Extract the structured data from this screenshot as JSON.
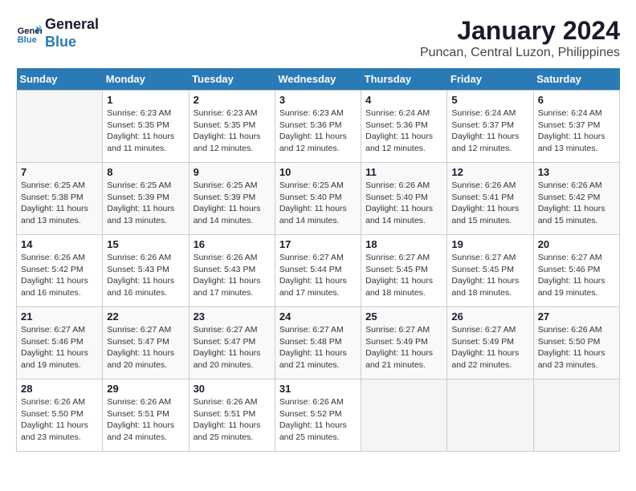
{
  "logo": {
    "line1": "General",
    "line2": "Blue"
  },
  "title": "January 2024",
  "subtitle": "Puncan, Central Luzon, Philippines",
  "days_of_week": [
    "Sunday",
    "Monday",
    "Tuesday",
    "Wednesday",
    "Thursday",
    "Friday",
    "Saturday"
  ],
  "weeks": [
    [
      {
        "day": "",
        "info": ""
      },
      {
        "day": "1",
        "info": "Sunrise: 6:23 AM\nSunset: 5:35 PM\nDaylight: 11 hours\nand 11 minutes."
      },
      {
        "day": "2",
        "info": "Sunrise: 6:23 AM\nSunset: 5:35 PM\nDaylight: 11 hours\nand 12 minutes."
      },
      {
        "day": "3",
        "info": "Sunrise: 6:23 AM\nSunset: 5:36 PM\nDaylight: 11 hours\nand 12 minutes."
      },
      {
        "day": "4",
        "info": "Sunrise: 6:24 AM\nSunset: 5:36 PM\nDaylight: 11 hours\nand 12 minutes."
      },
      {
        "day": "5",
        "info": "Sunrise: 6:24 AM\nSunset: 5:37 PM\nDaylight: 11 hours\nand 12 minutes."
      },
      {
        "day": "6",
        "info": "Sunrise: 6:24 AM\nSunset: 5:37 PM\nDaylight: 11 hours\nand 13 minutes."
      }
    ],
    [
      {
        "day": "7",
        "info": "Sunrise: 6:25 AM\nSunset: 5:38 PM\nDaylight: 11 hours\nand 13 minutes."
      },
      {
        "day": "8",
        "info": "Sunrise: 6:25 AM\nSunset: 5:39 PM\nDaylight: 11 hours\nand 13 minutes."
      },
      {
        "day": "9",
        "info": "Sunrise: 6:25 AM\nSunset: 5:39 PM\nDaylight: 11 hours\nand 14 minutes."
      },
      {
        "day": "10",
        "info": "Sunrise: 6:25 AM\nSunset: 5:40 PM\nDaylight: 11 hours\nand 14 minutes."
      },
      {
        "day": "11",
        "info": "Sunrise: 6:26 AM\nSunset: 5:40 PM\nDaylight: 11 hours\nand 14 minutes."
      },
      {
        "day": "12",
        "info": "Sunrise: 6:26 AM\nSunset: 5:41 PM\nDaylight: 11 hours\nand 15 minutes."
      },
      {
        "day": "13",
        "info": "Sunrise: 6:26 AM\nSunset: 5:42 PM\nDaylight: 11 hours\nand 15 minutes."
      }
    ],
    [
      {
        "day": "14",
        "info": "Sunrise: 6:26 AM\nSunset: 5:42 PM\nDaylight: 11 hours\nand 16 minutes."
      },
      {
        "day": "15",
        "info": "Sunrise: 6:26 AM\nSunset: 5:43 PM\nDaylight: 11 hours\nand 16 minutes."
      },
      {
        "day": "16",
        "info": "Sunrise: 6:26 AM\nSunset: 5:43 PM\nDaylight: 11 hours\nand 17 minutes."
      },
      {
        "day": "17",
        "info": "Sunrise: 6:27 AM\nSunset: 5:44 PM\nDaylight: 11 hours\nand 17 minutes."
      },
      {
        "day": "18",
        "info": "Sunrise: 6:27 AM\nSunset: 5:45 PM\nDaylight: 11 hours\nand 18 minutes."
      },
      {
        "day": "19",
        "info": "Sunrise: 6:27 AM\nSunset: 5:45 PM\nDaylight: 11 hours\nand 18 minutes."
      },
      {
        "day": "20",
        "info": "Sunrise: 6:27 AM\nSunset: 5:46 PM\nDaylight: 11 hours\nand 19 minutes."
      }
    ],
    [
      {
        "day": "21",
        "info": "Sunrise: 6:27 AM\nSunset: 5:46 PM\nDaylight: 11 hours\nand 19 minutes."
      },
      {
        "day": "22",
        "info": "Sunrise: 6:27 AM\nSunset: 5:47 PM\nDaylight: 11 hours\nand 20 minutes."
      },
      {
        "day": "23",
        "info": "Sunrise: 6:27 AM\nSunset: 5:47 PM\nDaylight: 11 hours\nand 20 minutes."
      },
      {
        "day": "24",
        "info": "Sunrise: 6:27 AM\nSunset: 5:48 PM\nDaylight: 11 hours\nand 21 minutes."
      },
      {
        "day": "25",
        "info": "Sunrise: 6:27 AM\nSunset: 5:49 PM\nDaylight: 11 hours\nand 21 minutes."
      },
      {
        "day": "26",
        "info": "Sunrise: 6:27 AM\nSunset: 5:49 PM\nDaylight: 11 hours\nand 22 minutes."
      },
      {
        "day": "27",
        "info": "Sunrise: 6:26 AM\nSunset: 5:50 PM\nDaylight: 11 hours\nand 23 minutes."
      }
    ],
    [
      {
        "day": "28",
        "info": "Sunrise: 6:26 AM\nSunset: 5:50 PM\nDaylight: 11 hours\nand 23 minutes."
      },
      {
        "day": "29",
        "info": "Sunrise: 6:26 AM\nSunset: 5:51 PM\nDaylight: 11 hours\nand 24 minutes."
      },
      {
        "day": "30",
        "info": "Sunrise: 6:26 AM\nSunset: 5:51 PM\nDaylight: 11 hours\nand 25 minutes."
      },
      {
        "day": "31",
        "info": "Sunrise: 6:26 AM\nSunset: 5:52 PM\nDaylight: 11 hours\nand 25 minutes."
      },
      {
        "day": "",
        "info": ""
      },
      {
        "day": "",
        "info": ""
      },
      {
        "day": "",
        "info": ""
      }
    ]
  ]
}
